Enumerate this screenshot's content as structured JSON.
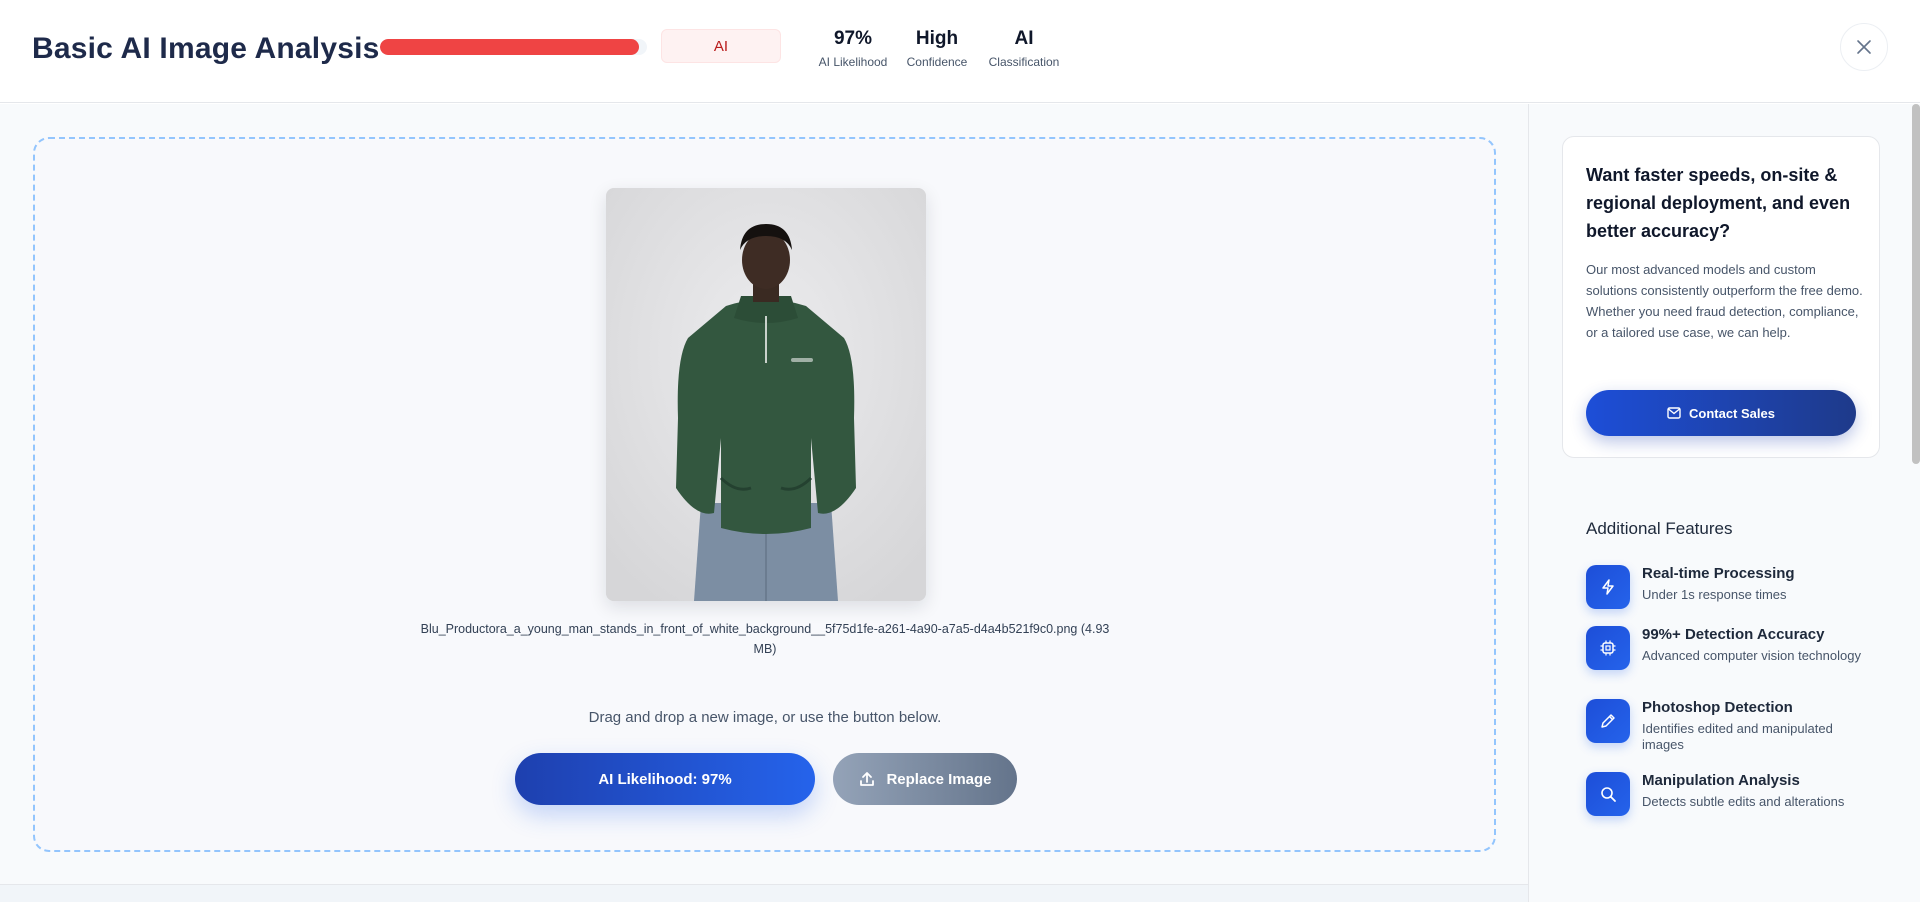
{
  "header": {
    "title": "Basic AI Image Analysis",
    "likelihood_fill": 0.97,
    "classification_badge": "AI",
    "stats": [
      {
        "value": "97%",
        "label": "AI Likelihood"
      },
      {
        "value": "High",
        "label": "Confidence"
      },
      {
        "value": "AI",
        "label": "Classification"
      }
    ],
    "close_icon": "close-icon"
  },
  "main": {
    "filename": "Blu_Productora_a_young_man_stands_in_front_of_white_background__5f75d1fe-a261-4a90-a7a5-d4a4b521f9c0.png (4.93 MB)",
    "hint": "Drag and drop a new image, or use the button below.",
    "primary_button": "AI Likelihood: 97%",
    "replace_button": "Replace Image",
    "replace_icon": "upload-icon"
  },
  "sidebar": {
    "promo": {
      "title": "Want faster speeds, on-site & regional deployment, and even better accuracy?",
      "text": "Our most advanced models and custom solutions consistently outperform the free demo. Whether you need fraud detection, compliance, or a tailored use case, we can help.",
      "button": "Contact Sales",
      "button_icon": "mail-icon"
    },
    "features_heading": "Additional Features",
    "features": [
      {
        "icon": "bolt-icon",
        "title": "Real-time Processing",
        "subtitle": "Under 1s response times"
      },
      {
        "icon": "chip-icon",
        "title": "99%+ Detection Accuracy",
        "subtitle": "Advanced computer vision technology"
      },
      {
        "icon": "pencil-icon",
        "title": "Photoshop Detection",
        "subtitle": "Identifies edited and manipulated images"
      },
      {
        "icon": "search-icon",
        "title": "Manipulation Analysis",
        "subtitle": "Detects subtle edits and alterations"
      }
    ]
  },
  "colors": {
    "accent": "#2563eb",
    "danger": "#ef4444",
    "title": "#1e2a4a"
  }
}
